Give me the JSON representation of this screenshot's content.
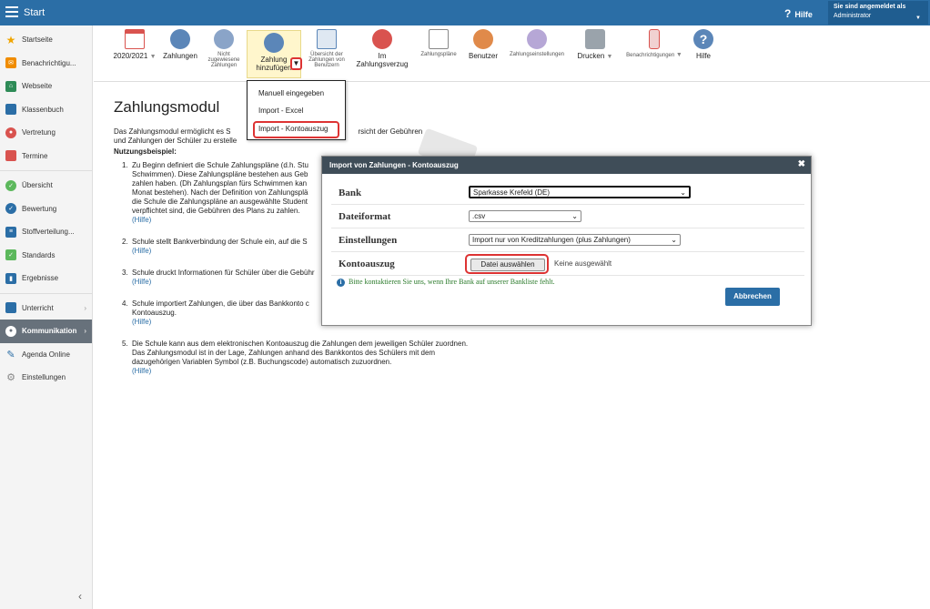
{
  "topbar": {
    "title": "Start",
    "help": "Hilfe",
    "login_line1": "Sie sind angemeldet als",
    "login_line2": "Administrator"
  },
  "sidebar": {
    "items": [
      {
        "label": "Startseite",
        "color": "#f0a500"
      },
      {
        "label": "Benachrichtigu...",
        "color": "#f08c00"
      },
      {
        "label": "Webseite",
        "color": "#2e8b57"
      },
      {
        "label": "Klassenbuch",
        "color": "#2b6ea6"
      },
      {
        "label": "Vertretung",
        "color": "#d9534f"
      },
      {
        "label": "Termine",
        "color": "#d9534f"
      },
      {
        "label": "Übersicht",
        "color": "#5cb85c"
      },
      {
        "label": "Bewertung",
        "color": "#2b6ea6"
      },
      {
        "label": "Stoffverteilung...",
        "color": "#2b6ea6"
      },
      {
        "label": "Standards",
        "color": "#5cb85c"
      },
      {
        "label": "Ergebnisse",
        "color": "#2b6ea6"
      },
      {
        "label": "Unterricht",
        "color": "#2b6ea6"
      },
      {
        "label": "Kommunikation",
        "color": "#ffffff"
      },
      {
        "label": "Agenda Online",
        "color": "#2b6ea6"
      },
      {
        "label": "Einstellungen",
        "color": "#888888"
      }
    ]
  },
  "toolbar": {
    "year": "2020/2021",
    "zahlungen": "Zahlungen",
    "nicht1": "Nicht",
    "nicht2": "zugewiesene",
    "nicht3": "Zahlungen",
    "add1": "Zahlung",
    "add2": "hinzufügen",
    "overview1": "Übersicht der",
    "overview2": "Zahlungen von",
    "overview3": "Benutzern",
    "verzug1": "Im",
    "verzug2": "Zahlungsverzug",
    "plaene": "Zahlungspläne",
    "benutzer": "Benutzer",
    "einst": "Zahlungseinstellungen",
    "drucken": "Drucken",
    "benach": "Benachrichtigungen",
    "hilfe": "Hilfe"
  },
  "dropdown": {
    "items": [
      "Manuell eingegeben",
      "Import - Excel",
      "Import - Kontoauszug"
    ]
  },
  "content": {
    "title": "Zahlungsmodul",
    "intro1": "Das Zahlungsmodul ermöglicht es S",
    "intro1b": "rsicht der Gebühren",
    "intro2": "und Zahlungen der Schüler zu erstelle",
    "usage": "Nutzungsbeispiel:",
    "help_text": "(Hilfe)",
    "step1_l1": "Zu Beginn definiert die Schule Zahlungspläne (d.h. Stu",
    "step1_l2": "Schwimmen). Diese Zahlungspläne bestehen aus Geb",
    "step1_l3": "zahlen haben. (Dh Zahlungsplan fürs Schwimmen kan",
    "step1_l4": "Monat bestehen). Nach der Definition von Zahlungsplä",
    "step1_l5": "die Schule die Zahlungspläne an ausgewählte Student",
    "step1_l6": "verpflichtet sind, die Gebühren des Plans zu zahlen.",
    "step2_l1": "Schule stellt Bankverbindung der Schule ein, auf die S",
    "step3_l1": "Schule druckt Informationen für Schüler über die Gebühr",
    "step4_l1": "Schule importiert Zahlungen, die über das Bankkonto c",
    "step4_l2": "Kontoauszug.",
    "step5_l1": "Die Schule kann aus dem elektronischen Kontoauszug die Zahlungen dem jeweiligen Schüler zuordnen.",
    "step5_l2": "Das Zahlungsmodul ist in der Lage, Zahlungen anhand des Bankkontos des Schülers mit dem",
    "step5_l3": "dazugehörigen Variablen Symbol (z.B. Buchungscode) automatisch zuzuordnen."
  },
  "modal": {
    "title": "Import von Zahlungen - Kontoauszug",
    "bank_label": "Bank",
    "bank_value": "Sparkasse Krefeld (DE)",
    "format_label": "Dateiformat",
    "format_value": ".csv",
    "settings_label": "Einstellungen",
    "settings_value": "Import nur von Kreditzahlungen (plus Zahlungen)",
    "statement_label": "Kontoauszug",
    "file_button": "Datei auswählen",
    "file_none": "Keine ausgewählt",
    "info": "Bitte kontaktieren Sie uns, wenn Ihre Bank auf unserer Bankliste fehlt.",
    "abort": "Abbrechen"
  }
}
